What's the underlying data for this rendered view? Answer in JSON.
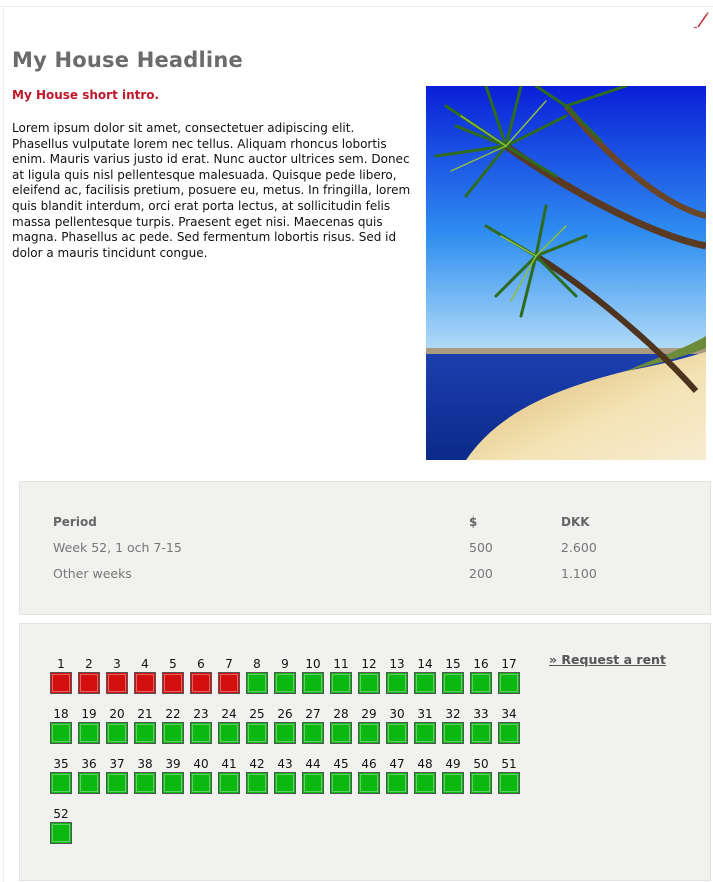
{
  "content": {
    "headline": "My House Headline",
    "intro": "My House short intro.",
    "body": "Lorem ipsum dolor sit amet, consectetuer adipiscing elit. Phasellus vulputate lorem nec tellus. Aliquam rhoncus lobortis enim. Mauris varius justo id erat. Nunc auctor ultrices sem. Donec at ligula quis nisl pellentesque malesuada. Quisque pede libero, eleifend ac, facilisis pretium, posuere eu, metus. In fringilla, lorem quis blandit interdum, orci erat porta lectus, at sollicitudin felis massa pellentesque turpis. Praesent eget nisi. Maecenas quis magna. Phasellus ac pede. Sed fermentum lobortis risus. Sed id dolor a mauris tincidunt congue."
  },
  "prices": {
    "headers": [
      "Period",
      "$",
      "DKK"
    ],
    "rows": [
      [
        "Week 52, 1 och 7-15",
        "500",
        "2.600"
      ],
      [
        "Other weeks",
        "200",
        "1.100"
      ]
    ]
  },
  "calendar": {
    "request_label": "» Request a rent",
    "weeks": [
      {
        "n": "1",
        "booked": true
      },
      {
        "n": "2",
        "booked": true
      },
      {
        "n": "3",
        "booked": true
      },
      {
        "n": "4",
        "booked": true
      },
      {
        "n": "5",
        "booked": true
      },
      {
        "n": "6",
        "booked": true
      },
      {
        "n": "7",
        "booked": true
      },
      {
        "n": "8",
        "booked": false
      },
      {
        "n": "9",
        "booked": false
      },
      {
        "n": "10",
        "booked": false
      },
      {
        "n": "11",
        "booked": false
      },
      {
        "n": "12",
        "booked": false
      },
      {
        "n": "13",
        "booked": false
      },
      {
        "n": "14",
        "booked": false
      },
      {
        "n": "15",
        "booked": false
      },
      {
        "n": "16",
        "booked": false
      },
      {
        "n": "17",
        "booked": false
      },
      {
        "n": "18",
        "booked": false
      },
      {
        "n": "19",
        "booked": false
      },
      {
        "n": "20",
        "booked": false
      },
      {
        "n": "21",
        "booked": false
      },
      {
        "n": "22",
        "booked": false
      },
      {
        "n": "23",
        "booked": false
      },
      {
        "n": "24",
        "booked": false
      },
      {
        "n": "25",
        "booked": false
      },
      {
        "n": "26",
        "booked": false
      },
      {
        "n": "27",
        "booked": false
      },
      {
        "n": "28",
        "booked": false
      },
      {
        "n": "29",
        "booked": false
      },
      {
        "n": "30",
        "booked": false
      },
      {
        "n": "31",
        "booked": false
      },
      {
        "n": "32",
        "booked": false
      },
      {
        "n": "33",
        "booked": false
      },
      {
        "n": "34",
        "booked": false
      },
      {
        "n": "35",
        "booked": false
      },
      {
        "n": "36",
        "booked": false
      },
      {
        "n": "37",
        "booked": false
      },
      {
        "n": "38",
        "booked": false
      },
      {
        "n": "39",
        "booked": false
      },
      {
        "n": "40",
        "booked": false
      },
      {
        "n": "41",
        "booked": false
      },
      {
        "n": "42",
        "booked": false
      },
      {
        "n": "43",
        "booked": false
      },
      {
        "n": "44",
        "booked": false
      },
      {
        "n": "45",
        "booked": false
      },
      {
        "n": "46",
        "booked": false
      },
      {
        "n": "47",
        "booked": false
      },
      {
        "n": "48",
        "booked": false
      },
      {
        "n": "49",
        "booked": false
      },
      {
        "n": "50",
        "booked": false
      },
      {
        "n": "51",
        "booked": false
      },
      {
        "n": "52",
        "booked": false
      }
    ]
  },
  "icons": {
    "edit": "edit-pencil-icon",
    "photo": "beach-palm-photo"
  },
  "colors": {
    "headline": "#6b6b6b",
    "intro": "#c0182b",
    "booked": "#d40f10",
    "free": "#0ab80f",
    "panel": "#f1f1ef"
  }
}
